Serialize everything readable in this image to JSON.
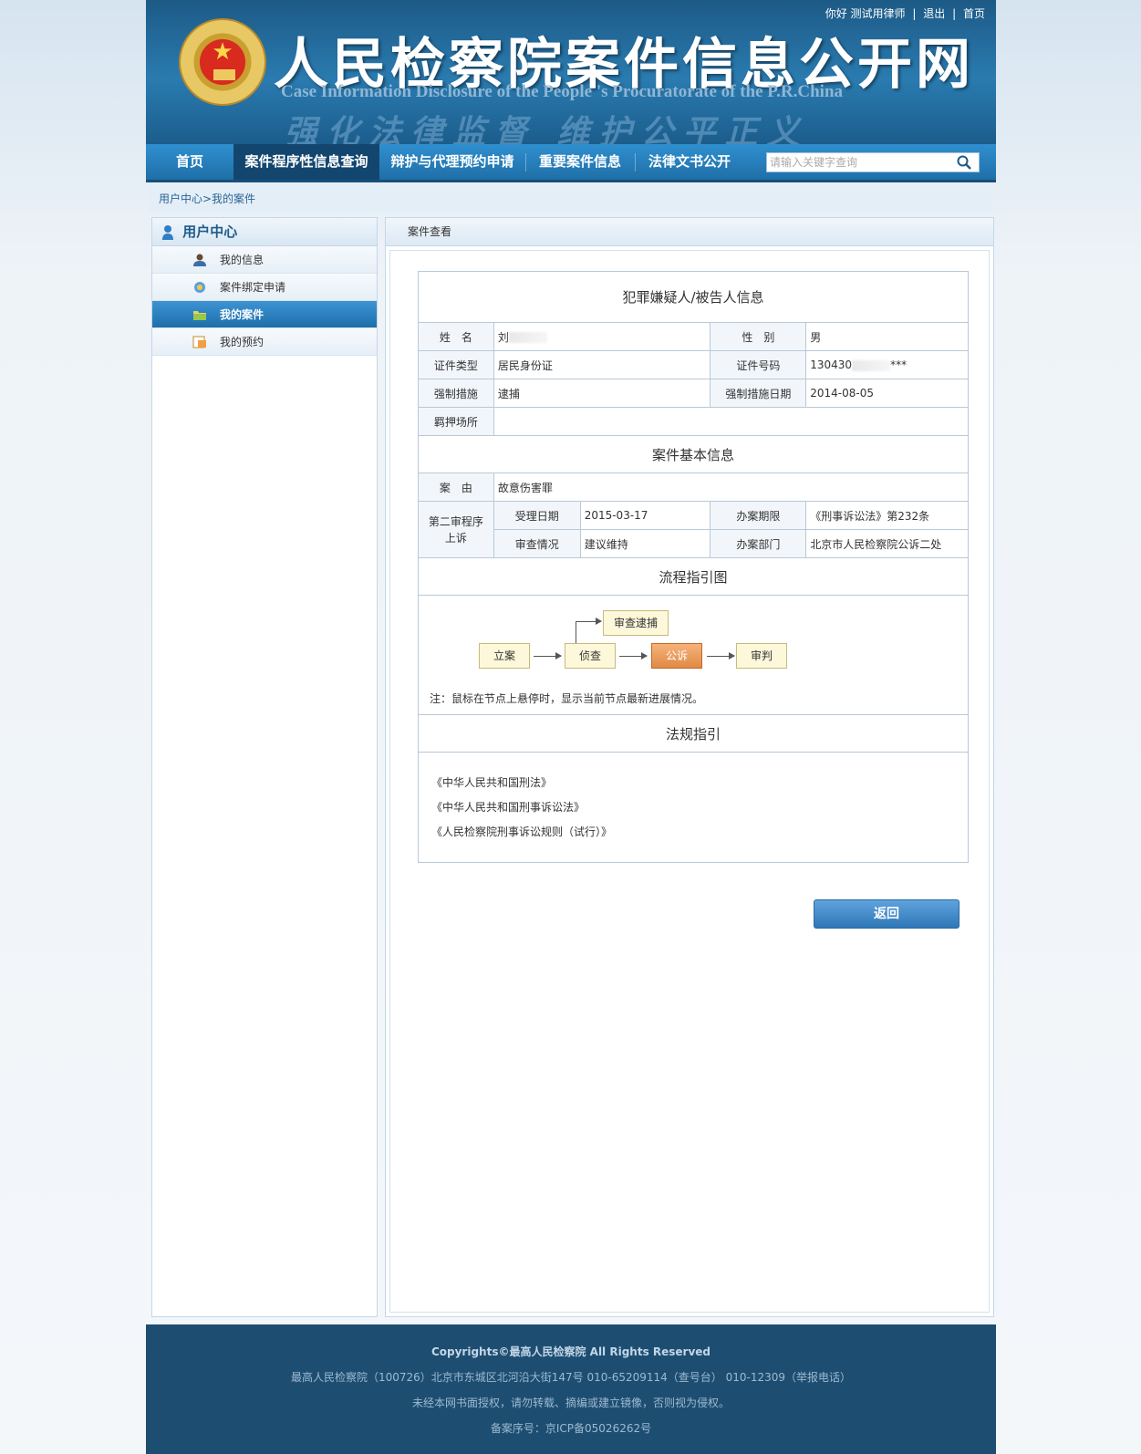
{
  "header": {
    "toplinks": {
      "greeting": "你好 测试用律师",
      "sep1": "|",
      "logout": "退出",
      "sep2": "|",
      "home": "首页"
    },
    "title": "人民检察院案件信息公开网",
    "subtitle": "Case Information Disclosure of the People 's Procuratorate of the P.R.China",
    "slogan": "强化法律监督 维护公平正义"
  },
  "nav": {
    "items": [
      "首页",
      "案件程序性信息查询",
      "辩护与代理预约申请",
      "重要案件信息",
      "法律文书公开"
    ],
    "active_index": 1,
    "search_placeholder": "请输入关键字查询"
  },
  "breadcrumb": "用户中心>我的案件",
  "sidebar": {
    "title": "用户中心",
    "items": [
      {
        "label": "我的信息",
        "icon": "user-icon"
      },
      {
        "label": "案件绑定申请",
        "icon": "badge-icon"
      },
      {
        "label": "我的案件",
        "icon": "folder-icon"
      },
      {
        "label": "我的预约",
        "icon": "calendar-icon"
      }
    ],
    "active_index": 2
  },
  "main": {
    "title": "案件查看",
    "suspect": {
      "section_title": "犯罪嫌疑人/被告人信息",
      "name_label": "姓　名",
      "name_value": "刘",
      "gender_label": "性　别",
      "gender_value": "男",
      "id_type_label": "证件类型",
      "id_type_value": "居民身份证",
      "id_no_label": "证件号码",
      "id_no_value": "130430",
      "id_no_suffix": "***",
      "measure_label": "强制措施",
      "measure_value": "逮捕",
      "measure_date_label": "强制措施日期",
      "measure_date_value": "2014-08-05",
      "custody_label": "羁押场所",
      "custody_value": ""
    },
    "case": {
      "section_title": "案件基本信息",
      "cause_label": "案　由",
      "cause_value": "故意伤害罪",
      "stage_label_1": "第二审程序",
      "stage_label_2": "上诉",
      "accept_date_label": "受理日期",
      "accept_date_value": "2015-03-17",
      "deadline_label": "办案期限",
      "deadline_value": "《刑事诉讼法》第232条",
      "review_label": "审查情况",
      "review_value": "建议维持",
      "dept_label": "办案部门",
      "dept_value": "北京市人民检察院公诉二处"
    },
    "flow": {
      "section_title": "流程指引图",
      "nodes": [
        "立案",
        "侦查",
        "公诉",
        "审判",
        "审查逮捕"
      ],
      "active_node": "公诉",
      "note": "注：鼠标在节点上悬停时，显示当前节点最新进展情况。"
    },
    "laws": {
      "section_title": "法规指引",
      "items": [
        "《中华人民共和国刑法》",
        "《中华人民共和国刑事诉讼法》",
        "《人民检察院刑事诉讼规则（试行）》"
      ]
    },
    "back_button": "返回"
  },
  "footer": {
    "copyright": "Copyrights©最高人民检察院 All Rights Reserved",
    "address": "最高人民检察院（100726）北京市东城区北河沿大街147号 010-65209114（查号台） 010-12309（举报电话）",
    "notice": "未经本网书面授权，请勿转载、摘编或建立镜像，否则视为侵权。",
    "icp": "备案序号：京ICP备05026262号"
  },
  "colors": {
    "header_blue": "#1d5a86",
    "nav_blue": "#2f8fcf",
    "active_nav": "#13466f",
    "footer": "#1d4e72",
    "flow_active": "#e08a45"
  }
}
